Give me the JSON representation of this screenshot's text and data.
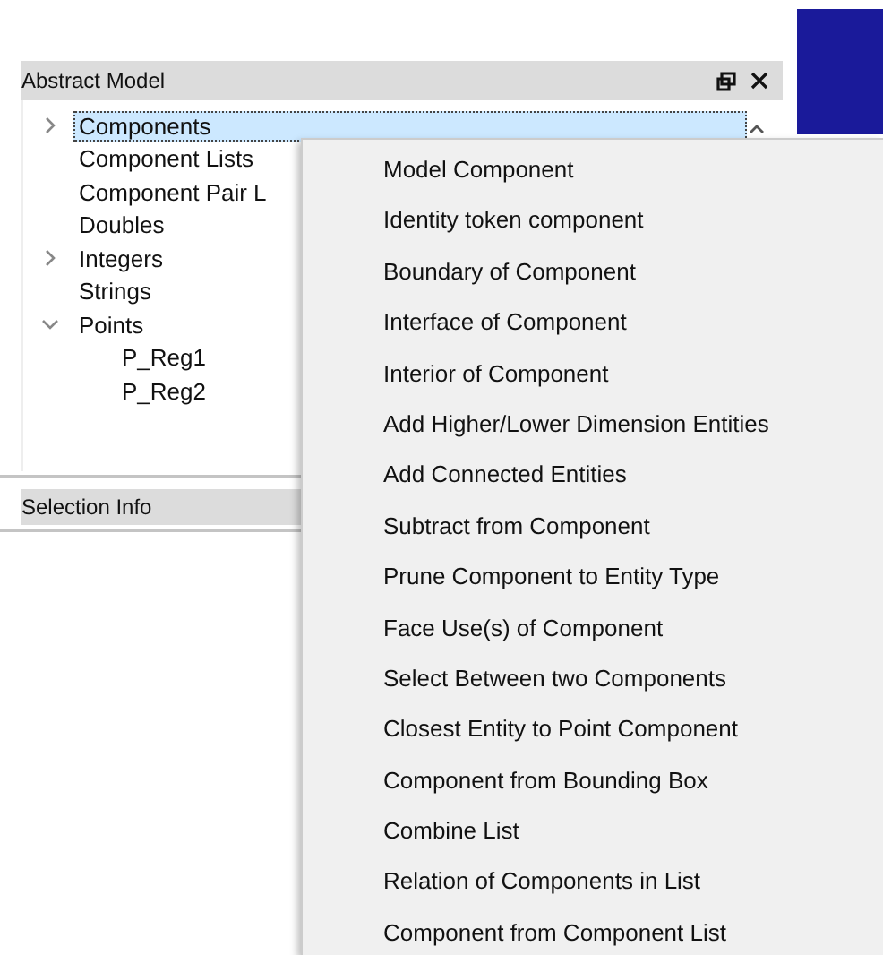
{
  "panel": {
    "title": "Abstract Model"
  },
  "tree": [
    {
      "label": "Components",
      "kind": "group",
      "expanded": false,
      "selected": true
    },
    {
      "label": "Component Lists",
      "kind": "leaf",
      "selected": false
    },
    {
      "label": "Component Pair L",
      "kind": "leaf",
      "selected": false
    },
    {
      "label": "Doubles",
      "kind": "leaf",
      "selected": false
    },
    {
      "label": "Integers",
      "kind": "group",
      "expanded": false,
      "selected": false
    },
    {
      "label": "Strings",
      "kind": "leaf",
      "selected": false
    },
    {
      "label": "Points",
      "kind": "group",
      "expanded": true,
      "selected": false,
      "children": [
        {
          "label": "P_Reg1",
          "selected": false
        },
        {
          "label": "P_Reg2",
          "selected": false
        }
      ]
    }
  ],
  "selection_panel": {
    "title": "Selection Info"
  },
  "context_menu": [
    "Model Component",
    "Identity token component",
    "Boundary of Component",
    "Interface of Component",
    "Interior of Component",
    "Add Higher/Lower Dimension Entities",
    "Add Connected Entities",
    "Subtract from Component",
    "Prune Component to Entity Type",
    "Face Use(s) of Component",
    "Select Between two Components",
    "Closest Entity to Point Component",
    "Component from Bounding Box",
    "Combine List",
    "Relation of Components in List",
    "Component from Component List"
  ]
}
